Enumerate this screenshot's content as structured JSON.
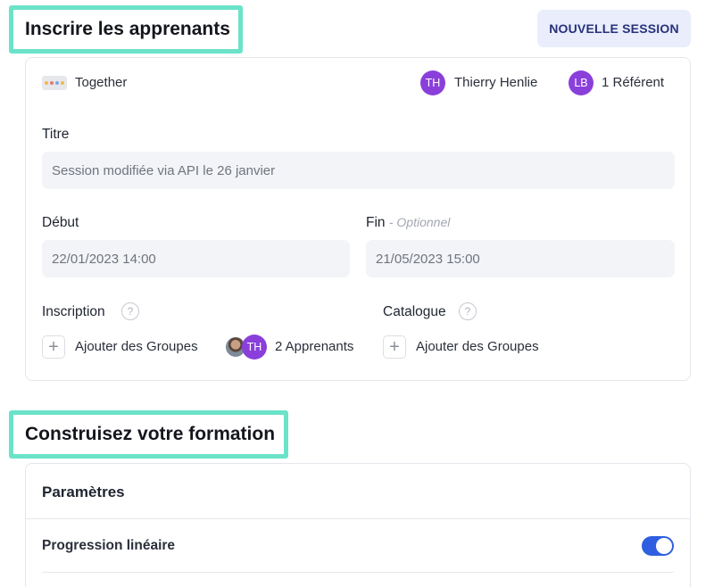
{
  "header": {
    "enroll_title": "Inscrire les apprenants",
    "new_session_label": "NOUVELLE SESSION"
  },
  "session": {
    "tag_label": "Together",
    "owner": {
      "initials": "TH",
      "name": "Thierry Henlie",
      "color": "#8a3fdb"
    },
    "referent": {
      "initials": "LB",
      "label": "1 Référent",
      "color": "#8a3fdb"
    },
    "title_label": "Titre",
    "title_value": "Session modifiée via API le 26 janvier",
    "start_label": "Début",
    "start_value": "22/01/2023 14:00",
    "end_label": "Fin",
    "end_optional": "- Optionnel",
    "end_value": "21/05/2023 15:00",
    "enrollment": {
      "label": "Inscription",
      "add_groups": "Ajouter des Groupes",
      "learners_avatar_initials": "TH",
      "learners_label": "2 Apprenants"
    },
    "catalog": {
      "label": "Catalogue",
      "add_groups": "Ajouter des Groupes"
    }
  },
  "build": {
    "title": "Construisez votre formation",
    "params_title": "Paramètres",
    "linear_progression_label": "Progression linéaire",
    "linear_progression_enabled": true
  },
  "colors": {
    "accent": "#2f5fe0",
    "highlight_border": "#6be3c9",
    "avatar": "#8a3fdb",
    "button_bg": "#e9edfc"
  }
}
